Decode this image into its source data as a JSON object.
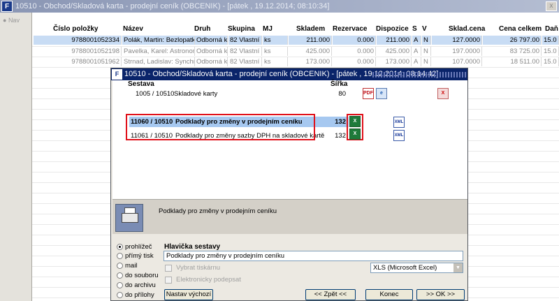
{
  "bg_window": {
    "title": "10510 - Obchod/Skladová karta - prodejní ceník (OBCENIK) - [pátek , 19.12.2014; 08:10:34]",
    "close_glyph": "x",
    "nav_label": "Nav"
  },
  "grid": {
    "columns": [
      "Číslo položky",
      "Název",
      "Druh",
      "Skupina",
      "MJ",
      "Skladem",
      "Rezervace",
      "Dispozice",
      "S",
      "V",
      "Sklad.cena",
      "Cena celkem",
      "Daň"
    ],
    "rows": [
      {
        "cislo": "9788001052334",
        "nazev": "Polák, Martin: Bezlopatkov",
        "druh": "Odborná kn",
        "skupina": "82 Vlastní z",
        "mj": "ks",
        "skladem": "211.000",
        "rezervace": "0.000",
        "dispozice": "211.000",
        "s": "A",
        "v": "N",
        "cena": "127.0000",
        "celkem": "26 797.00",
        "dan": "15.0"
      },
      {
        "cislo": "9788001052198",
        "nazev": "Pavelka, Karel: Astronomi",
        "druh": "Odborná kn",
        "skupina": "82 Vlastní z",
        "mj": "ks",
        "skladem": "425.000",
        "rezervace": "0.000",
        "dispozice": "425.000",
        "s": "A",
        "v": "N",
        "cena": "197.0000",
        "celkem": "83 725.00",
        "dan": "15.0"
      },
      {
        "cislo": "9788001051962",
        "nazev": "Strnad, Ladislav: Synchro",
        "druh": "Odborná kn",
        "skupina": "82 Vlastní z",
        "mj": "ks",
        "skladem": "173.000",
        "rezervace": "0.000",
        "dispozice": "173.000",
        "s": "A",
        "v": "N",
        "cena": "107.0000",
        "celkem": "18 511.00",
        "dan": "15.0"
      }
    ]
  },
  "dialog": {
    "title": "10510 - Obchod/Skladová karta - prodejní ceník (OBCENIK) - [pátek , 19.12.2014; 08:14:42]",
    "col_sestava": "Sestava",
    "col_sirka": "Šířka",
    "reports": [
      {
        "code": "1005 / 10510",
        "name": "Skladové karty",
        "width": "80"
      },
      {
        "code": "11060 / 10510",
        "name": "Podklady pro změny v prodejním ceníku",
        "width": "132"
      },
      {
        "code": "11061 / 10510",
        "name": "Podklady pro změny sazby DPH na skladové kartě",
        "width": "132"
      }
    ],
    "icon_labels": {
      "pdf": "PDF",
      "web": "e",
      "xls": "X",
      "xml": "XML",
      "close": "X"
    },
    "info_text": "Podklady pro změny v prodejním ceníku",
    "output_options": [
      "prohlížeč",
      "přímý tisk",
      "mail",
      "do souboru",
      "do archivu",
      "do přílohy"
    ],
    "selected_output": "prohlížeč",
    "header_label": "Hlavička sestavy",
    "header_value": "Podklady pro změny v prodejním ceníku",
    "checkbox_printer": "Vybrat tiskárnu",
    "checkbox_sign": "Elektronicky podepsat",
    "format_value": "XLS (Microsoft Excel)",
    "buttons": {
      "defaults": "Nastav výchozí",
      "back": "<< Zpět <<",
      "end": "Konec",
      "ok": ">> OK >>"
    }
  }
}
